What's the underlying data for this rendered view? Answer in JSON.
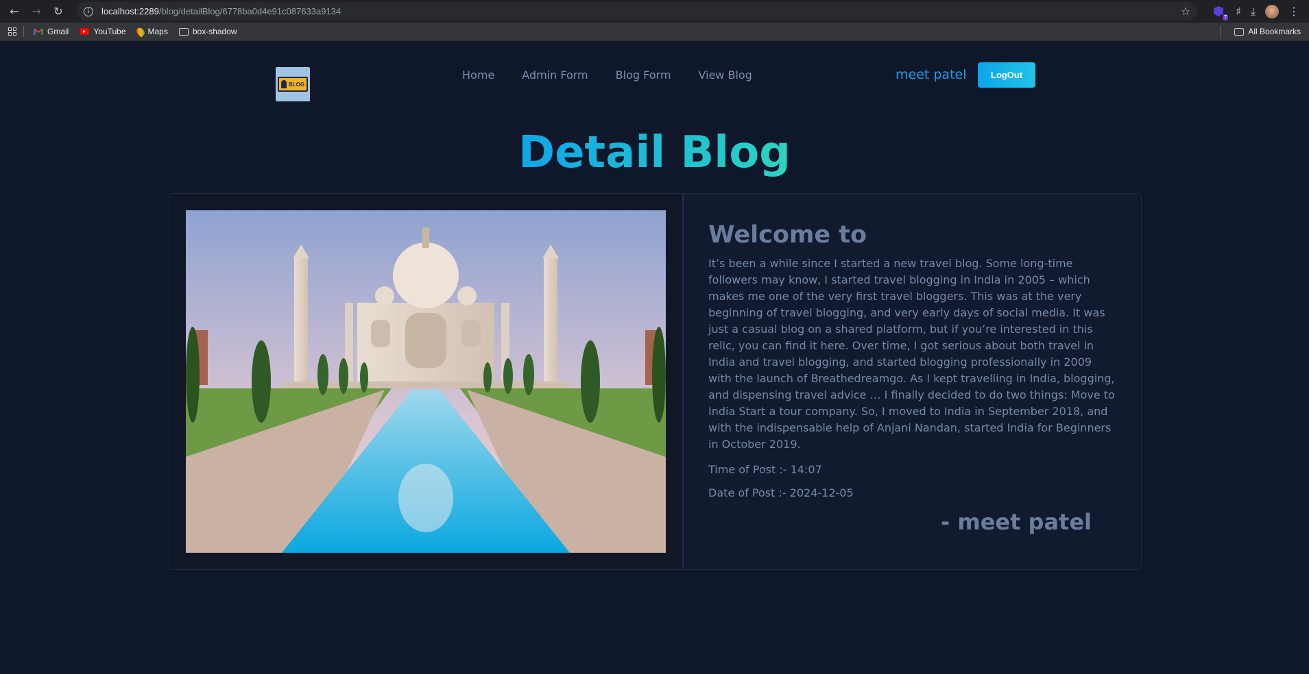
{
  "browser": {
    "url_host": "localhost:2289",
    "url_path": "/blog/detailBlog/6778ba0d4e91c087633a9134",
    "extension_badge": "7",
    "bookmarks": [
      {
        "label": "Gmail",
        "icon": "gmail-icon"
      },
      {
        "label": "YouTube",
        "icon": "youtube-icon"
      },
      {
        "label": "Maps",
        "icon": "maps-icon"
      },
      {
        "label": "box-shadow",
        "icon": "folder-icon"
      }
    ],
    "all_bookmarks": "All Bookmarks"
  },
  "nav": {
    "logo_text": "BLOG",
    "links": [
      "Home",
      "Admin Form",
      "Blog Form",
      "View Blog"
    ],
    "username": "meet patel",
    "logout_label": "LogOut"
  },
  "page": {
    "title": "Detail Blog"
  },
  "blog": {
    "heading": "Welcome to",
    "body": "It’s been a while since I started a new travel blog. Some long-time followers may know, I started travel blogging in India in 2005 – which makes me one of the very first travel bloggers. This was at the very beginning of travel blogging, and very early days of social media. It was just a casual blog on a shared platform, but if you’re interested in this relic, you can find it here. Over time, I got serious about both travel in India and travel blogging, and started blogging professionally in 2009 with the launch of Breathedreamgo. As I kept travelling in India, blogging, and dispensing travel advice … I finally decided to do two things: Move to India Start a tour company. So, I moved to India in September 2018, and with the indispensable help of Anjani Nandan, started India for Beginners in October 2019.",
    "time_of_post": "Time of Post :- 14:07",
    "date_of_post": "Date of Post :- 2024-12-05",
    "author": "- meet patel"
  },
  "colors": {
    "page_bg": "#0f172a",
    "accent": "#0ea5e9",
    "accent2": "#2dd4bf",
    "text_muted": "#7589aa"
  }
}
